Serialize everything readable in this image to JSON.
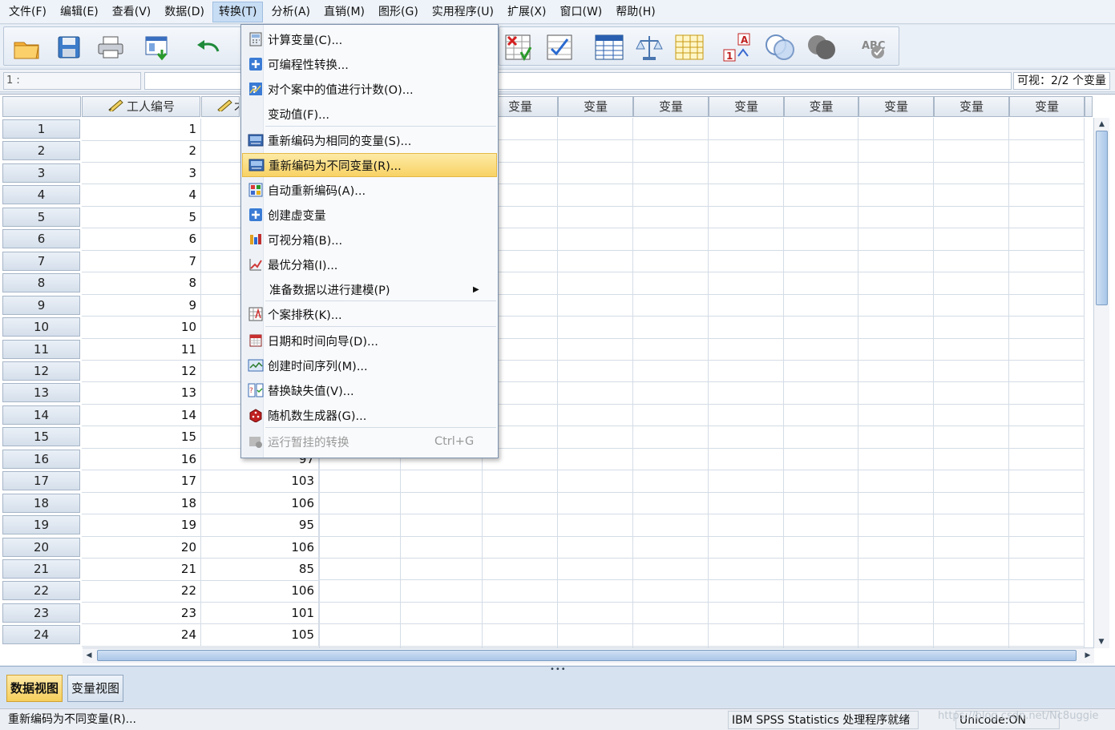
{
  "menubar": {
    "items": [
      "文件(F)",
      "编辑(E)",
      "查看(V)",
      "数据(D)",
      "转换(T)",
      "分析(A)",
      "直销(M)",
      "图形(G)",
      "实用程序(U)",
      "扩展(X)",
      "窗口(W)",
      "帮助(H)"
    ],
    "active_index": 4
  },
  "transform_menu": {
    "items": [
      {
        "label": "计算变量(C)...",
        "icon": "calculator-icon"
      },
      {
        "label": "可编程性转换...",
        "icon": "plus-icon"
      },
      {
        "label": "对个案中的值进行计数(O)...",
        "icon": "count-values-icon"
      },
      {
        "label": "变动值(F)...",
        "icon": ""
      },
      {
        "label": "重新编码为相同的变量(S)...",
        "icon": "recode-icon"
      },
      {
        "label": "重新编码为不同变量(R)...",
        "icon": "recode-icon"
      },
      {
        "label": "自动重新编码(A)...",
        "icon": "auto-recode-icon"
      },
      {
        "label": "创建虚变量",
        "icon": "plus-icon"
      },
      {
        "label": "可视分箱(B)...",
        "icon": "visual-binning-icon"
      },
      {
        "label": "最优分箱(I)...",
        "icon": "optimal-binning-icon"
      },
      {
        "label": "准备数据以进行建模(P)",
        "icon": ""
      },
      {
        "label": "个案排秩(K)...",
        "icon": "rank-cases-icon"
      },
      {
        "label": "日期和时间向导(D)...",
        "icon": "calendar-icon"
      },
      {
        "label": "创建时间序列(M)...",
        "icon": "time-series-icon"
      },
      {
        "label": "替换缺失值(V)...",
        "icon": "replace-missing-icon"
      },
      {
        "label": "随机数生成器(G)...",
        "icon": "dice-icon"
      },
      {
        "label": "运行暂挂的转换",
        "icon": "pending-transform-icon",
        "shortcut": "Ctrl+G",
        "disabled": true
      }
    ],
    "highlighted_index": 5,
    "submenu_index": 10
  },
  "editbar": {
    "cell_ref": "1 :",
    "visible_count": "可视：2/2 个变量"
  },
  "grid": {
    "col1_header": "工人编号",
    "col2_header_visible": "才",
    "var_header": "变量",
    "rows": [
      "1",
      "2",
      "3",
      "4",
      "5",
      "6",
      "7",
      "8",
      "9",
      "10",
      "11",
      "12",
      "13",
      "14",
      "15",
      "16",
      "17",
      "18",
      "19",
      "20",
      "21",
      "22",
      "23",
      "24"
    ],
    "col1": [
      "1",
      "2",
      "3",
      "4",
      "5",
      "6",
      "7",
      "8",
      "9",
      "10",
      "11",
      "12",
      "13",
      "14",
      "15",
      "16",
      "17",
      "18",
      "19",
      "20",
      "21",
      "22",
      "23",
      "24"
    ],
    "col2_visible": {
      "16": "97",
      "17": "103",
      "18": "106",
      "19": "95",
      "20": "106",
      "21": "85",
      "22": "106",
      "23": "101",
      "24": "105"
    }
  },
  "tabs": {
    "data_view": "数据视图",
    "variable_view": "变量视图",
    "active": "data_view"
  },
  "status": {
    "left": "重新编码为不同变量(R)...",
    "processor": "IBM SPSS Statistics 处理程序就绪",
    "unicode": "Unicode:ON",
    "watermark": "https://blog.csdn.net/Nc8uggie"
  },
  "colors": {
    "accent": "#f8d264",
    "menu_active": "#c7ddf4",
    "header_bg": "#dfe6ef"
  }
}
